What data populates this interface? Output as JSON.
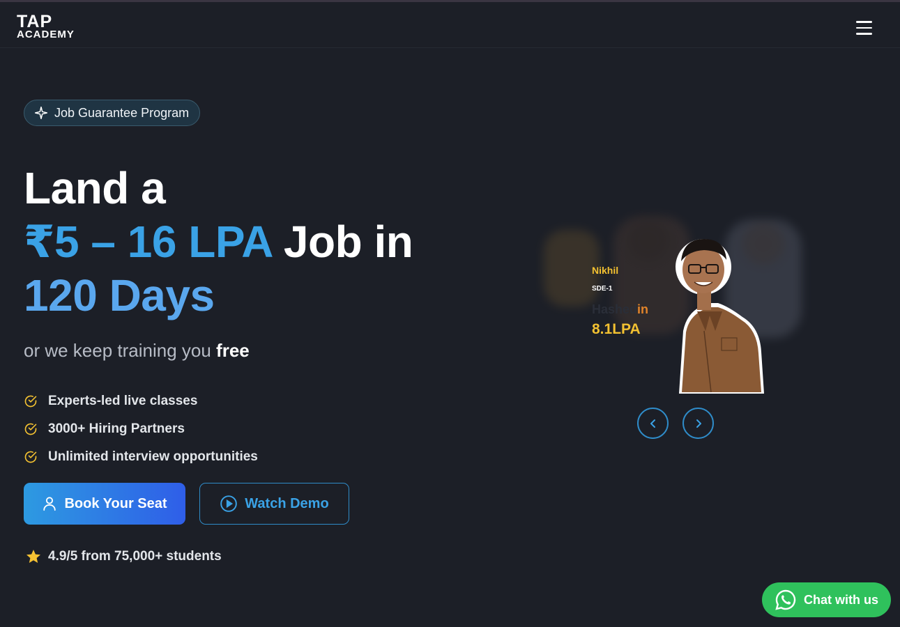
{
  "nav": {
    "logo_line1": "TAP",
    "logo_line2": "ACADEMY",
    "menu_icon": "hamburger-icon"
  },
  "hero": {
    "badge": "Job Guarantee Program",
    "headline_line1": "Land a",
    "headline_highlight": "₹5 – 16 LPA",
    "headline_line2_rest": " Job in",
    "headline_line3": "120 Days",
    "subline_prefix": "or we keep training you ",
    "subline_bold": "free",
    "features": [
      "Experts-led live classes",
      "3000+ Hiring Partners",
      "Unlimited interview opportunities"
    ],
    "book_button": "Book Your Seat",
    "watch_button": "Watch Demo",
    "rating_text": "4.9/5 from 75,000+ students"
  },
  "carousel": {
    "name": "Nikhil",
    "role": "SDE-1",
    "company_prefix": "Hashed",
    "company_suffix": "in",
    "package": "8.1LPA"
  },
  "chat": {
    "label": "Chat with us"
  },
  "colors": {
    "background": "#1c1f27",
    "accent_blue": "#3aa2e6",
    "gold": "#f3c131",
    "whatsapp_green": "#2fc15c"
  }
}
